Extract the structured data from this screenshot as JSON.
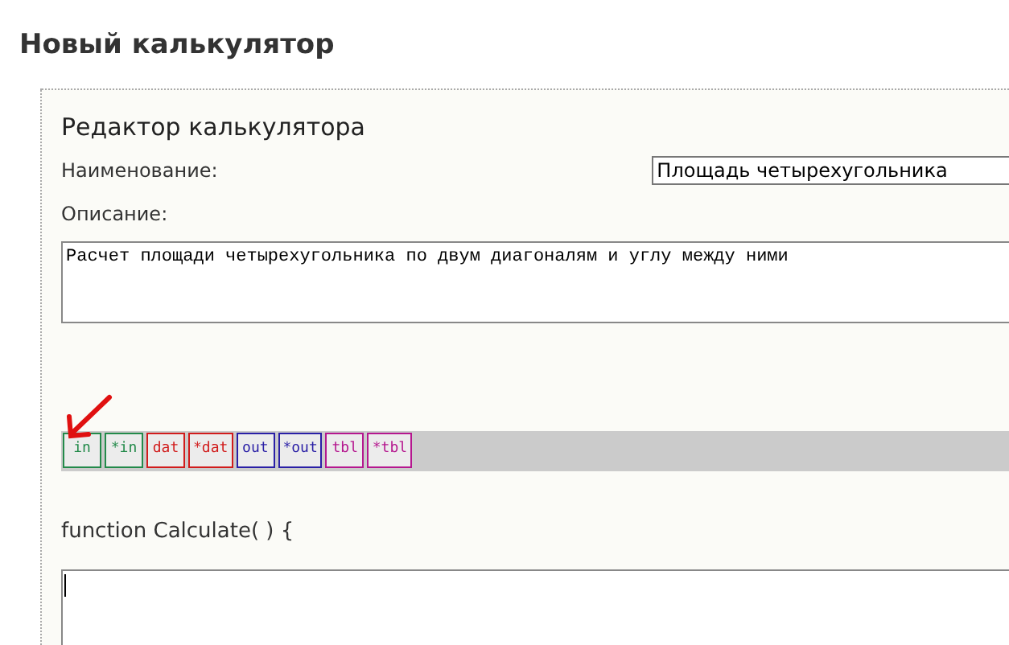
{
  "page_title": "Новый калькулятор",
  "editor": {
    "title": "Редактор калькулятора",
    "name_label": "Наименование:",
    "name_value": "Площадь четырехугольника",
    "description_label": "Описание:",
    "description_value": "Расчет площади четырехугольника по двум диагоналям и углу между ними",
    "toolbar": [
      {
        "label": "in",
        "color": "#238a4a"
      },
      {
        "label": "*in",
        "color": "#238a4a"
      },
      {
        "label": "dat",
        "color": "#d11c1c"
      },
      {
        "label": "*dat",
        "color": "#d11c1c"
      },
      {
        "label": "out",
        "color": "#2a1fa6"
      },
      {
        "label": "*out",
        "color": "#2a1fa6"
      },
      {
        "label": "tbl",
        "color": "#b5178f"
      },
      {
        "label": "*tbl",
        "color": "#b5178f"
      }
    ],
    "function_header": "function Calculate( ) {"
  }
}
